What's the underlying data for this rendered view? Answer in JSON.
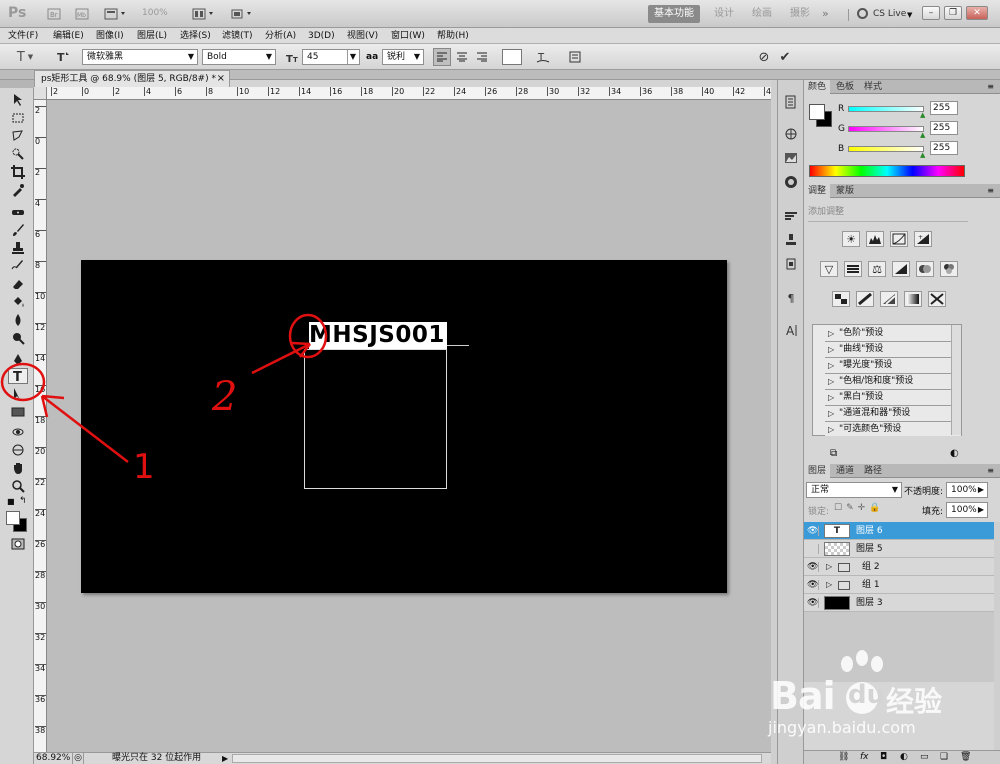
{
  "app": {
    "logo": "Ps",
    "zoom": "100%",
    "workspaces": [
      "基本功能",
      "设计",
      "绘画",
      "摄影"
    ],
    "more": "»",
    "cslive": "CS Live",
    "colors": {
      "accent": "#3b9bd8",
      "canvas": "#000000",
      "workarea": "#bdbdbd",
      "annotation": "#e01010"
    }
  },
  "menu": [
    "文件(F)",
    "编辑(E)",
    "图像(I)",
    "图层(L)",
    "选择(S)",
    "滤镜(T)",
    "分析(A)",
    "3D(D)",
    "视图(V)",
    "窗口(W)",
    "帮助(H)"
  ],
  "options": {
    "tool_icon": "T",
    "font_family": "微软雅黑",
    "font_style": "Bold",
    "font_size": "45",
    "aa_label": "aa",
    "aa_method": "锐利"
  },
  "document": {
    "tab_title": "ps矩形工具 @ 68.9% (图层 5, RGB/8#) *",
    "close": "×",
    "text_content": "MHSJS001",
    "zoom": "68.92%",
    "status": "曝光只在 32 位起作用",
    "ruler_h": [
      "2",
      "0",
      "2",
      "4",
      "6",
      "8",
      "10",
      "12",
      "14",
      "16",
      "18",
      "20",
      "22",
      "24",
      "26",
      "28",
      "30",
      "32",
      "34",
      "36",
      "38",
      "40",
      "42",
      "44"
    ],
    "ruler_v": [
      "2",
      "0",
      "2",
      "4",
      "6",
      "8",
      "10",
      "12",
      "14",
      "16",
      "18",
      "20",
      "22",
      "24",
      "26",
      "28",
      "30",
      "32",
      "34",
      "36",
      "38"
    ]
  },
  "annotations": {
    "one": "1",
    "two": "2"
  },
  "color_panel": {
    "tabs": [
      "颜色",
      "色板",
      "样式"
    ],
    "r_label": "R",
    "g_label": "G",
    "b_label": "B",
    "r": "255",
    "g": "255",
    "b": "255"
  },
  "adjust_panel": {
    "tabs": [
      "调整",
      "蒙版"
    ],
    "heading": "添加调整",
    "presets": [
      "\"色阶\"预设",
      "\"曲线\"预设",
      "\"曝光度\"预设",
      "\"色相/饱和度\"预设",
      "\"黑白\"预设",
      "\"通道混和器\"预设",
      "\"可选颜色\"预设"
    ]
  },
  "layers_panel": {
    "tabs": [
      "图层",
      "通道",
      "路径"
    ],
    "blend_mode": "正常",
    "opacity_label": "不透明度:",
    "opacity": "100%",
    "lock_label": "锁定:",
    "fill_label": "填充:",
    "fill": "100%",
    "layers": [
      {
        "name": "图层 6",
        "type": "text",
        "visible": true,
        "selected": true
      },
      {
        "name": "图层 5",
        "type": "transparent",
        "visible": false,
        "selected": false
      },
      {
        "name": "组 2",
        "type": "group",
        "visible": true,
        "selected": false
      },
      {
        "name": "组 1",
        "type": "group",
        "visible": true,
        "selected": false
      },
      {
        "name": "图层 3",
        "type": "black",
        "visible": true,
        "selected": false
      }
    ],
    "footer_icons": [
      "link-icon",
      "fx-icon",
      "mask-icon",
      "adjustment-icon",
      "folder-icon",
      "new-layer-icon",
      "trash-icon"
    ],
    "fx_label": "fx"
  },
  "watermark": {
    "brand": "Bai",
    "brand2": "du",
    "cn": "经验",
    "url": "jingyan.baidu.com"
  }
}
